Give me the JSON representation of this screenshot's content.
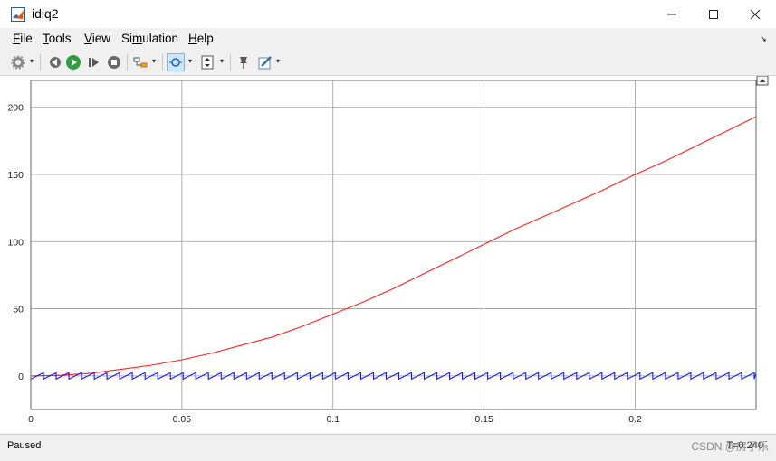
{
  "window": {
    "title": "idiq2",
    "controls": [
      "—",
      "☐",
      "✕"
    ]
  },
  "menu": [
    {
      "label": "File",
      "key": "F",
      "rest": "ile"
    },
    {
      "label": "Tools",
      "key": "T",
      "rest": "ools"
    },
    {
      "label": "View",
      "key": "V",
      "rest": "iew"
    },
    {
      "label": "Simulation",
      "key": "",
      "rest": "Si",
      "key2": "m",
      "rest2": "ulation"
    },
    {
      "label": "Help",
      "key": "H",
      "rest": "elp"
    }
  ],
  "toolbar": {
    "icons": [
      "gear-icon",
      "step-back-icon",
      "run-icon",
      "step-forward-icon",
      "stop-icon",
      "highlight-icon",
      "zoom-icon",
      "autoscale-icon",
      "pin-icon",
      "edit-icon"
    ]
  },
  "status": {
    "state": "Paused",
    "time_label": "T=0.240",
    "watermark": "CSDN @房子乐"
  },
  "chart_data": {
    "type": "line",
    "xlim": [
      0,
      0.24
    ],
    "ylim": [
      -25,
      220
    ],
    "x_ticks": [
      "0",
      "0.05",
      "0.1",
      "0.15",
      "0.2"
    ],
    "y_ticks": [
      "0",
      "50",
      "100",
      "150",
      "200"
    ],
    "grid": true,
    "series": [
      {
        "color": "#ff2020",
        "x": [
          0,
          0.01,
          0.02,
          0.03,
          0.04,
          0.05,
          0.06,
          0.07,
          0.08,
          0.09,
          0.1,
          0.11,
          0.12,
          0.13,
          0.14,
          0.15,
          0.16,
          0.17,
          0.18,
          0.19,
          0.2,
          0.21,
          0.22,
          0.23,
          0.24
        ],
        "y": [
          0,
          0.5,
          2,
          5,
          8,
          12,
          17,
          23,
          29,
          37,
          46,
          55,
          65,
          76,
          87,
          98,
          109,
          119,
          129,
          139,
          150,
          160,
          171,
          182,
          193
        ]
      },
      {
        "color": "#1a1aee",
        "x": [
          0,
          0.24
        ],
        "y": [
          0,
          0
        ],
        "pattern": "sawtooth",
        "amplitude": 4,
        "period": 0.0042
      }
    ]
  }
}
